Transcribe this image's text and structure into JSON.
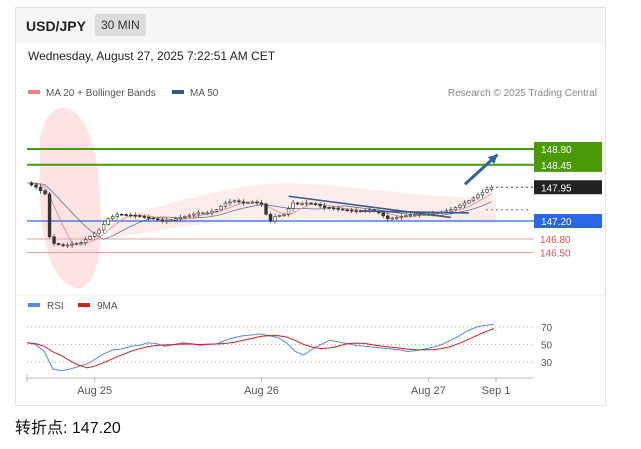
{
  "header": {
    "symbol": "USD/JPY",
    "timeframe": "30 MIN"
  },
  "datetime": "Wednesday, August 27, 2025 7:22:51 AM CET",
  "legend": {
    "ma20": {
      "label": "MA 20 + Bollinger Bands",
      "color": "#f08080"
    },
    "ma50": {
      "label": "MA 50",
      "color": "#34597f"
    }
  },
  "credit": "Research © 2025 Trading Central",
  "footer": "转折点: 147.20",
  "chart_data": {
    "type": "candlestick",
    "price_levels": [
      {
        "value": 148.8,
        "label": "148.80",
        "style": "resistance",
        "color": "#4a9a06"
      },
      {
        "value": 148.45,
        "label": "148.45",
        "style": "resistance",
        "color": "#4a9a06"
      },
      {
        "value": 147.95,
        "label": "147.95",
        "style": "last",
        "color": "#222222"
      },
      {
        "value": 147.2,
        "label": "147.20",
        "style": "pivot",
        "color": "#2a67e6"
      },
      {
        "value": 146.8,
        "label": "146.80",
        "style": "support",
        "color": "#d9534f"
      },
      {
        "value": 146.5,
        "label": "146.50",
        "style": "support",
        "color": "#d9534f"
      }
    ],
    "price_path": [
      [
        0,
        148.05
      ],
      [
        2,
        147.95
      ],
      [
        4,
        147.8
      ],
      [
        5,
        146.85
      ],
      [
        6,
        146.7
      ],
      [
        8,
        146.65
      ],
      [
        12,
        146.72
      ],
      [
        16,
        147.0
      ],
      [
        18,
        147.25
      ],
      [
        20,
        147.35
      ],
      [
        24,
        147.32
      ],
      [
        28,
        147.25
      ],
      [
        30,
        147.2
      ],
      [
        32,
        147.22
      ],
      [
        34,
        147.28
      ],
      [
        36,
        147.33
      ],
      [
        38,
        147.38
      ],
      [
        40,
        147.38
      ],
      [
        42,
        147.45
      ],
      [
        44,
        147.6
      ],
      [
        46,
        147.65
      ],
      [
        48,
        147.6
      ],
      [
        50,
        147.62
      ],
      [
        52,
        147.58
      ],
      [
        53,
        147.35
      ],
      [
        54,
        147.2
      ],
      [
        55,
        147.3
      ],
      [
        57,
        147.35
      ],
      [
        59,
        147.6
      ],
      [
        60,
        147.58
      ],
      [
        62,
        147.6
      ],
      [
        64,
        147.57
      ],
      [
        66,
        147.5
      ],
      [
        68,
        147.48
      ],
      [
        70,
        147.45
      ],
      [
        72,
        147.43
      ],
      [
        74,
        147.42
      ],
      [
        76,
        147.45
      ],
      [
        78,
        147.38
      ],
      [
        80,
        147.25
      ],
      [
        82,
        147.28
      ],
      [
        84,
        147.32
      ],
      [
        86,
        147.35
      ],
      [
        88,
        147.35
      ],
      [
        90,
        147.37
      ],
      [
        92,
        147.4
      ],
      [
        94,
        147.45
      ],
      [
        96,
        147.55
      ],
      [
        98,
        147.65
      ],
      [
        100,
        147.78
      ],
      [
        102,
        147.9
      ],
      [
        103,
        147.95
      ]
    ],
    "trend_lines": [
      {
        "color": "#3e5a86",
        "points": [
          [
            58,
            147.75
          ],
          [
            94,
            147.28
          ]
        ]
      },
      {
        "color": "#3e5a86",
        "points": [
          [
            74,
            147.42
          ],
          [
            98,
            147.38
          ]
        ]
      }
    ],
    "forecast_arrow": {
      "from": [
        96,
        147.95
      ],
      "to": [
        103,
        148.72
      ],
      "color": "#2c62a8"
    },
    "x_ticks": [
      {
        "pos": 15,
        "label": "Aug 25"
      },
      {
        "pos": 52,
        "label": "Aug 26"
      },
      {
        "pos": 89,
        "label": "Aug 27"
      },
      {
        "pos": 104,
        "label": "Sep 1"
      }
    ],
    "rsi": {
      "name": "RSI",
      "color": "#5b8bd6",
      "ma_name": "9MA",
      "ma_color": "#cc2222",
      "levels": [
        70,
        50,
        30
      ],
      "values": [
        52,
        50,
        42,
        22,
        20,
        22,
        25,
        28,
        34,
        40,
        44,
        45,
        48,
        49,
        52,
        51,
        48,
        50,
        52,
        51,
        49,
        50,
        51,
        55,
        58,
        60,
        61,
        62,
        60,
        58,
        52,
        42,
        38,
        45,
        50,
        55,
        53,
        51,
        49,
        48,
        47,
        46,
        45,
        44,
        42,
        43,
        45,
        47,
        50,
        55,
        60,
        66,
        70,
        72,
        73
      ]
    }
  }
}
